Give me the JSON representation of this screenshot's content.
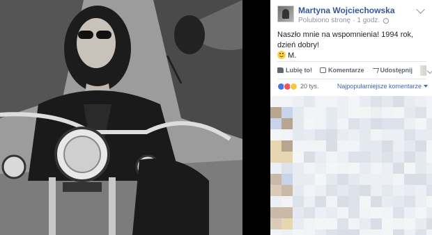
{
  "post": {
    "author": "Martyna Wojciechowska",
    "liked_page": "Polubiono stronę",
    "separator": "·",
    "time": "1 godz.",
    "text": "Naszło mnie na wspomnienia! 1994 rok, dzień dobry!",
    "signature": "M."
  },
  "actions": {
    "like": "Lubię to!",
    "comment": "Komentarze",
    "share": "Udostępnij"
  },
  "reactions": {
    "count": "20 tys.",
    "sort": "Najpopularniejsze komentarze"
  },
  "icons": [
    "chevron-down-icon",
    "globe-icon",
    "smile-icon",
    "like-icon",
    "comment-icon",
    "share-icon",
    "reaction-like-icon",
    "reaction-love-icon",
    "reaction-wow-icon",
    "caret-icon"
  ],
  "colors": {
    "link": "#365899",
    "accent": "#4267b2",
    "text": "#1d2129",
    "muted": "#90949c",
    "background": "#000000"
  }
}
